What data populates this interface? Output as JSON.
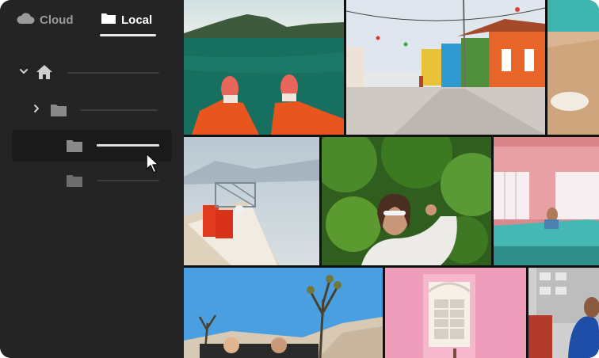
{
  "tabs": {
    "cloud": "Cloud",
    "local": "Local",
    "active": "Local"
  },
  "tree": {
    "rows": [
      {
        "icon": "home-icon",
        "expanded": true
      },
      {
        "icon": "folder-icon",
        "expanded": false
      },
      {
        "icon": "folder-icon",
        "selected": true
      },
      {
        "icon": "folder-icon"
      }
    ]
  },
  "photos": [
    "lake-feet-boat-photo",
    "colorful-street-photo",
    "cropped-edge-photo",
    "rowboat-lake-photo",
    "woman-sunglasses-foliage-photo",
    "pink-house-car-photo",
    "desert-joshua-tree-photo",
    "pink-window-photo",
    "building-portrait-photo"
  ],
  "colors": {
    "sidebar": "#242424",
    "selected_row": "#1a1a1a",
    "active_text": "#ffffff",
    "inactive_text": "#9a9a9a"
  }
}
